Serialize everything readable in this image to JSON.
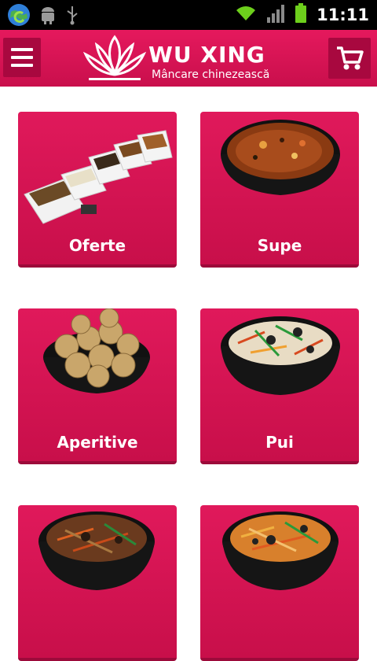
{
  "status_bar": {
    "time": "11:11"
  },
  "app": {
    "title": "WU XING",
    "subtitle": "Mâncare chinezească"
  },
  "categories": [
    {
      "label": "Oferte"
    },
    {
      "label": "Supe"
    },
    {
      "label": "Aperitive"
    },
    {
      "label": "Pui"
    },
    {
      "label": ""
    },
    {
      "label": ""
    }
  ],
  "colors": {
    "brand": "#d6145a",
    "brand_dark": "#a8083f"
  }
}
